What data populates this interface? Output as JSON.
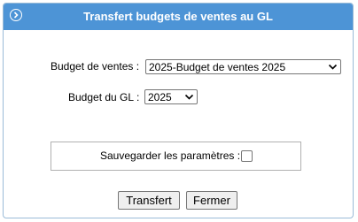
{
  "dialog": {
    "title": "Transfert budgets de ventes au GL",
    "title_icon": "chevron-right-circle-icon"
  },
  "form": {
    "budget_ventes_label": "Budget de ventes :",
    "budget_ventes_value": "2025-Budget de ventes 2025",
    "budget_gl_label": "Budget du GL :",
    "budget_gl_value": "2025",
    "save_params_label": "Sauvegarder les paramètres :",
    "save_params_checked": false
  },
  "buttons": {
    "transfer_label": "Transfert",
    "close_label": "Fermer"
  },
  "colors": {
    "titlebar": "#4d94d6",
    "border": "#9bbcd8"
  }
}
